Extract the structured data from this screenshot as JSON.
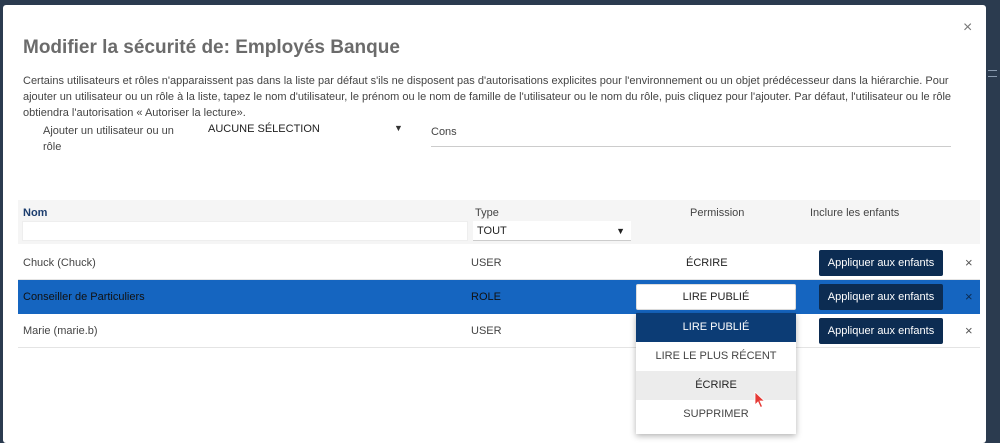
{
  "modal": {
    "title": "Modifier la sécurité de: Employés Banque",
    "close_icon": "×",
    "description": "Certains utilisateurs et rôles n'apparaissent pas dans la liste par défaut s'ils ne disposent pas d'autorisations explicites pour l'environnement ou un objet prédécesseur dans la hiérarchie. Pour ajouter un utilisateur ou un rôle à la liste, tapez le nom d'utilisateur, le prénom ou le nom de famille de l'utilisateur ou le nom du rôle, puis cliquez pour l'ajouter. Par défaut, l'utilisateur ou le rôle obtiendra l'autorisation « Autoriser la lecture»."
  },
  "add": {
    "label": "Ajouter un utilisateur ou un rôle",
    "select_value": "AUCUNE SÉLECTION",
    "search_value": "Cons"
  },
  "table": {
    "headers": {
      "name": "Nom",
      "type": "Type",
      "permission": "Permission",
      "children": "Inclure les enfants"
    },
    "type_filter": "TOUT",
    "rows": [
      {
        "name": "Chuck (Chuck)",
        "type": "USER",
        "permission": "ÉCRIRE",
        "apply_label": "Appliquer aux enfants",
        "remove": "×"
      },
      {
        "name": "Conseiller de Particuliers",
        "type": "ROLE",
        "permission": "LIRE PUBLIÉ",
        "apply_label": "Appliquer aux enfants",
        "remove": "×"
      },
      {
        "name": "Marie (marie.b)",
        "type": "USER",
        "permission": "",
        "apply_label": "Appliquer aux enfants",
        "remove": "×"
      }
    ]
  },
  "dropdown": {
    "options": [
      "LIRE PUBLIÉ",
      "LIRE LE PLUS RÉCENT",
      "ÉCRIRE",
      "SUPPRIMER"
    ]
  },
  "colors": {
    "selected_row": "#1565c0",
    "button": "#0c2c52",
    "header_accent": "#1c3d6e",
    "cursor": "#e53935"
  }
}
